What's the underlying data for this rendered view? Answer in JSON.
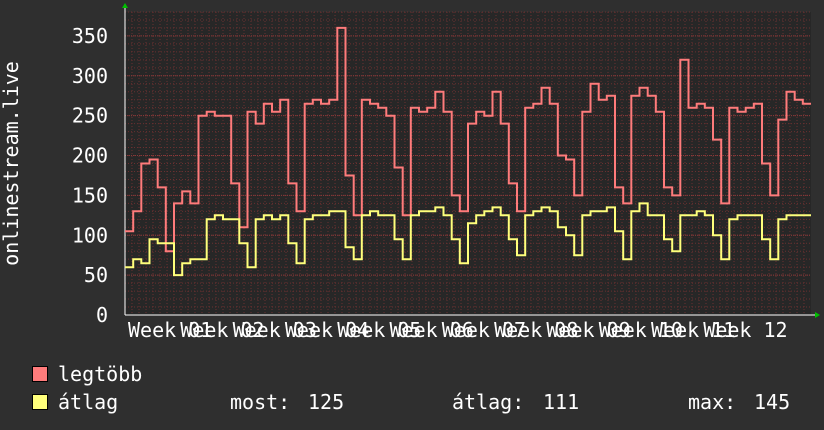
{
  "chart_data": {
    "type": "line",
    "ylabel": "onlinestream.live",
    "ylim": [
      0,
      380
    ],
    "yticks": [
      0,
      50,
      100,
      150,
      200,
      250,
      300,
      350
    ],
    "categories": [
      "Week 01",
      "Week 02",
      "Week 03",
      "Week 04",
      "Week 05",
      "Week 06",
      "Week 07",
      "Week 08",
      "Week 09",
      "Week 10",
      "Week 11",
      "Week 12"
    ],
    "x_tick_labels": [
      "Week 01",
      "Week 02",
      "Week 03",
      "Week 04",
      "Week 05",
      "Week 06",
      "Week 07",
      "Week 08",
      "Week 09",
      "Week 10",
      "Week 11",
      "Week 12"
    ],
    "grid": true,
    "series": [
      {
        "name": "legtöbb",
        "color": "#ff7b7b",
        "values": [
          105,
          130,
          190,
          195,
          160,
          80,
          140,
          155,
          140,
          250,
          255,
          250,
          250,
          165,
          110,
          255,
          240,
          265,
          255,
          270,
          165,
          130,
          265,
          270,
          265,
          270,
          360,
          175,
          125,
          270,
          265,
          260,
          250,
          185,
          125,
          260,
          255,
          260,
          280,
          255,
          150,
          130,
          240,
          255,
          250,
          280,
          240,
          165,
          130,
          260,
          265,
          285,
          265,
          200,
          195,
          150,
          255,
          290,
          270,
          275,
          160,
          140,
          275,
          285,
          275,
          255,
          160,
          150,
          320,
          260,
          265,
          260,
          220,
          140,
          260,
          255,
          260,
          265,
          190,
          150,
          245,
          280,
          270,
          265
        ],
        "y_range_observed": [
          80,
          360
        ]
      },
      {
        "name": "átlag",
        "color": "#ffff7b",
        "values": [
          60,
          70,
          65,
          95,
          90,
          90,
          50,
          65,
          70,
          70,
          120,
          125,
          120,
          120,
          90,
          60,
          120,
          125,
          120,
          125,
          90,
          65,
          120,
          125,
          125,
          130,
          130,
          85,
          70,
          125,
          130,
          125,
          125,
          95,
          70,
          125,
          130,
          130,
          135,
          125,
          95,
          65,
          115,
          125,
          130,
          135,
          125,
          95,
          75,
          125,
          130,
          135,
          130,
          110,
          100,
          75,
          125,
          130,
          130,
          135,
          105,
          70,
          130,
          140,
          125,
          125,
          95,
          80,
          125,
          125,
          130,
          125,
          100,
          70,
          120,
          125,
          125,
          125,
          95,
          70,
          120,
          125,
          125,
          125
        ]
      }
    ],
    "legend": [
      {
        "label": "legtöbb",
        "color": "#ff7b7b"
      },
      {
        "label": "átlag",
        "color": "#ffff7b"
      }
    ],
    "stats": {
      "most_label": "most:",
      "most_value": "125",
      "atlag_label": "átlag:",
      "atlag_value": "111",
      "max_label": "max:",
      "max_value": "145"
    }
  }
}
